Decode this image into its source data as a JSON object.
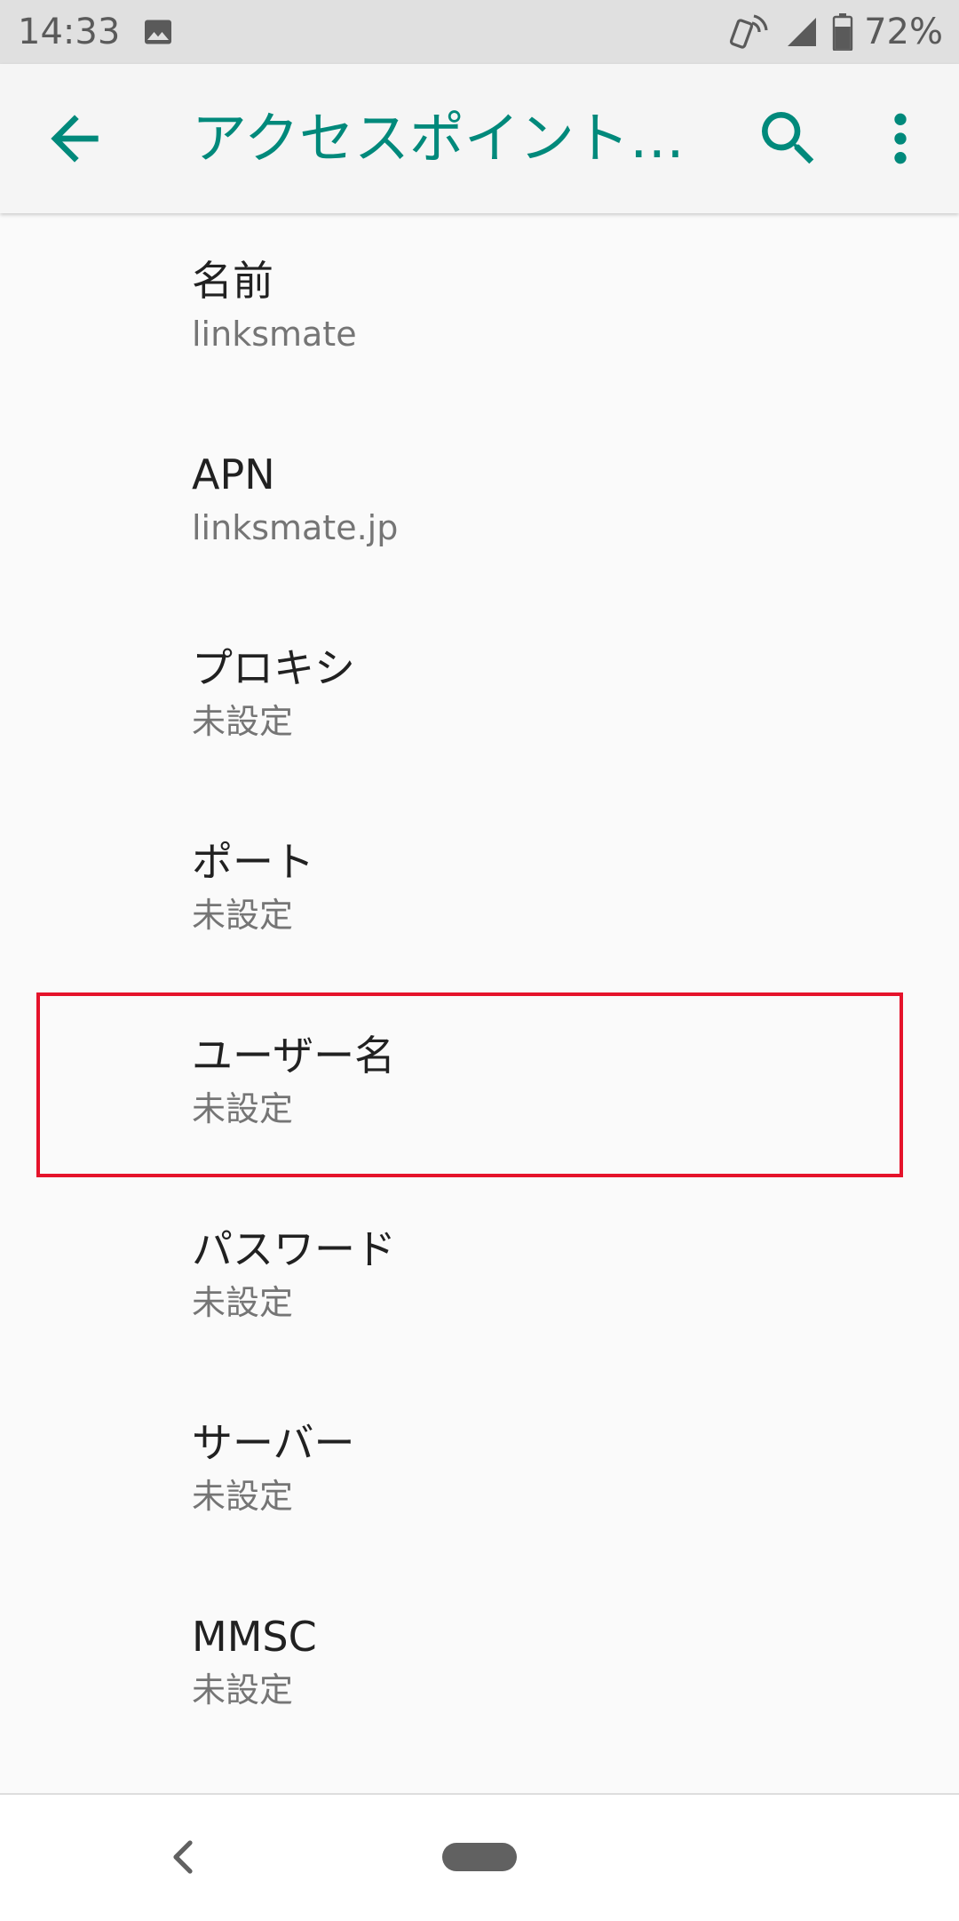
{
  "status_bar": {
    "time": "14:33",
    "battery_percent": "72%",
    "icons": [
      "image-icon",
      "nfc-phone-icon",
      "signal-icon",
      "battery-icon"
    ]
  },
  "app_bar": {
    "title": "アクセスポイント…",
    "accent_color": "#00897b",
    "icons": [
      "back-arrow-icon",
      "search-icon",
      "more-vert-icon"
    ]
  },
  "settings": {
    "items": [
      {
        "label": "名前",
        "value": "linksmate"
      },
      {
        "label": "APN",
        "value": "linksmate.jp"
      },
      {
        "label": "プロキシ",
        "value": "未設定"
      },
      {
        "label": "ポート",
        "value": "未設定"
      },
      {
        "label": "ユーザー名",
        "value": "未設定"
      },
      {
        "label": "パスワード",
        "value": "未設定"
      },
      {
        "label": "サーバー",
        "value": "未設定"
      },
      {
        "label": "MMSC",
        "value": "未設定"
      }
    ]
  },
  "highlight": {
    "target_item": "ユーザー名",
    "color": "#e5132b"
  },
  "nav_bar": {
    "icons": [
      "nav-back-icon",
      "home-pill-icon"
    ]
  }
}
